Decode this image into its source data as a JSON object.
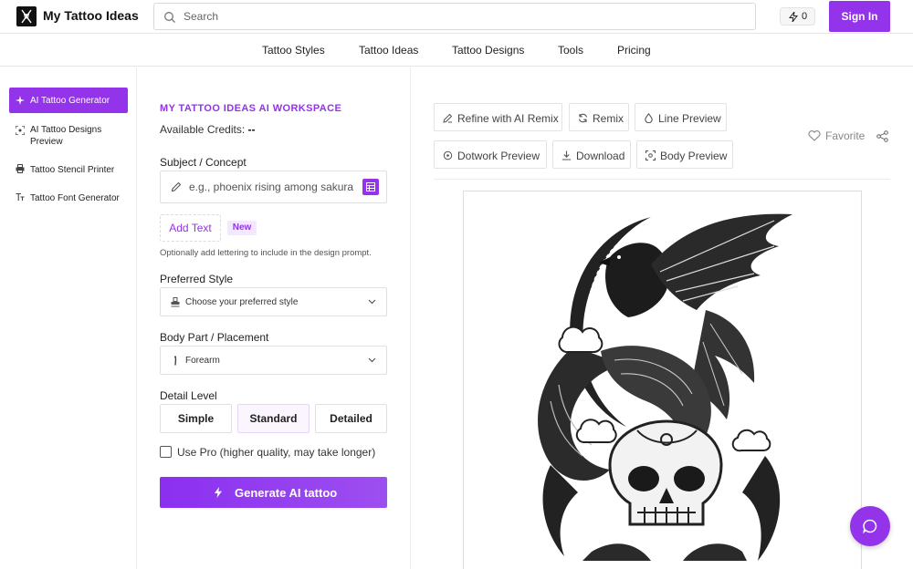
{
  "brand": {
    "name": "My Tattoo Ideas",
    "accent": "#9333ea"
  },
  "header": {
    "search_placeholder": "Search",
    "credits_count": "0",
    "signin_label": "Sign In"
  },
  "nav": {
    "items": [
      "Tattoo Styles",
      "Tattoo Ideas",
      "Tattoo Designs",
      "Tools",
      "Pricing"
    ]
  },
  "sidebar": {
    "items": [
      {
        "label": "AI Tattoo Generator",
        "icon": "sparkle-icon",
        "active": true
      },
      {
        "label": "AI Tattoo Designs Preview",
        "icon": "scan-icon",
        "active": false
      },
      {
        "label": "Tattoo Stencil Printer",
        "icon": "printer-icon",
        "active": false
      },
      {
        "label": "Tattoo Font Generator",
        "icon": "font-icon",
        "active": false
      }
    ]
  },
  "form": {
    "heading": "MY TATTOO IDEAS AI WORKSPACE",
    "credits_label": "Available Credits:",
    "credits_value": "--",
    "subject_label": "Subject / Concept",
    "subject_placeholder": "e.g., phoenix rising among sakura b",
    "add_text_label": "Add Text",
    "new_badge": "New",
    "hint": "Optionally add lettering to include in the design prompt.",
    "style_label": "Preferred Style",
    "style_value": "Choose your preferred style",
    "placement_label": "Body Part / Placement",
    "placement_value": "Forearm",
    "detail_label": "Detail Level",
    "detail_options": [
      "Simple",
      "Standard",
      "Detailed"
    ],
    "detail_selected": "Standard",
    "pro_label": "Use Pro (higher quality, may take longer)",
    "pro_checked": false,
    "generate_label": "Generate AI tattoo"
  },
  "preview": {
    "toolbar": [
      {
        "label": "Refine with AI Remix",
        "icon": "edit-icon"
      },
      {
        "label": "Remix",
        "icon": "refresh-icon"
      },
      {
        "label": "Line Preview",
        "icon": "droplet-icon"
      },
      {
        "label": "Dotwork Preview",
        "icon": "target-icon"
      },
      {
        "label": "Download",
        "icon": "download-icon"
      },
      {
        "label": "Body Preview",
        "icon": "scan-icon"
      }
    ],
    "favorite_label": "Favorite"
  }
}
